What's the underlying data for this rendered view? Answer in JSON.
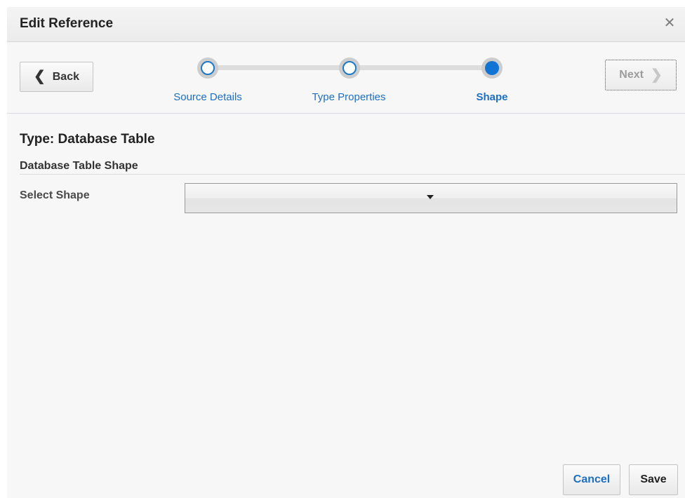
{
  "dialog": {
    "title": "Edit Reference",
    "close_icon": "close-icon"
  },
  "train": {
    "back_label": "Back",
    "next_label": "Next",
    "stops": [
      {
        "label": "Source Details",
        "state": "visited"
      },
      {
        "label": "Type Properties",
        "state": "visited"
      },
      {
        "label": "Shape",
        "state": "current"
      }
    ]
  },
  "content": {
    "type_heading": "Type: Database Table",
    "section_heading": "Database Table Shape",
    "select_shape_label": "Select Shape",
    "select_shape_value": ""
  },
  "footer": {
    "cancel_label": "Cancel",
    "save_label": "Save"
  },
  "colors": {
    "accent": "#1174d4",
    "link": "#1d6fc2",
    "background": "#f7f7f7"
  }
}
